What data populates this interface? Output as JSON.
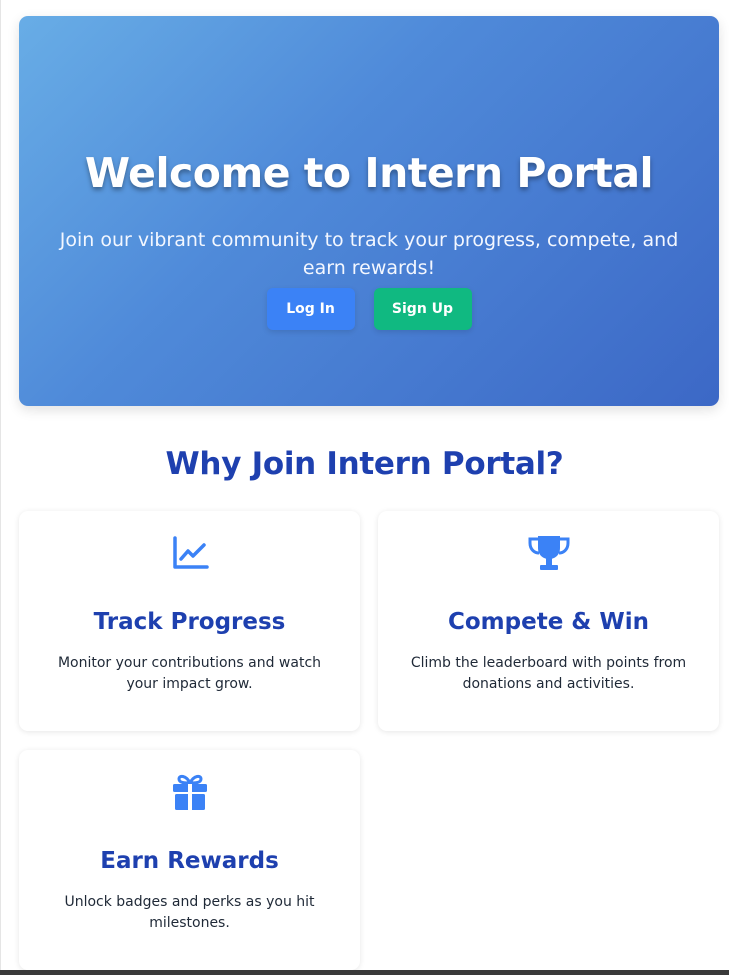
{
  "hero": {
    "title": "Welcome to Intern Portal",
    "subtitle": "Join our vibrant community to track your progress, compete, and earn rewards!",
    "login_label": "Log In",
    "signup_label": "Sign Up"
  },
  "features": {
    "heading": "Why Join Intern Portal?",
    "items": [
      {
        "icon": "chart-line-icon",
        "title": "Track Progress",
        "description": "Monitor your contributions and watch your impact grow."
      },
      {
        "icon": "trophy-icon",
        "title": "Compete & Win",
        "description": "Climb the leaderboard with points from donations and activities."
      },
      {
        "icon": "gift-icon",
        "title": "Earn Rewards",
        "description": "Unlock badges and perks as you hit milestones."
      }
    ]
  },
  "colors": {
    "accent_blue": "#3b82f6",
    "accent_green": "#10b981",
    "heading_blue": "#1e40af"
  }
}
